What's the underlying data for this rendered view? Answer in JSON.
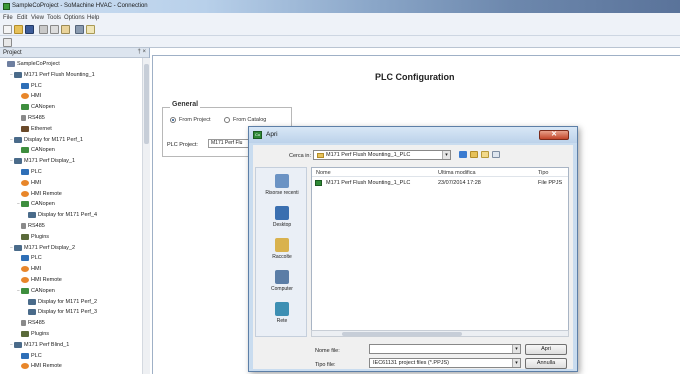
{
  "window": {
    "title": "SampleCoProject - SoMachine HVAC - Connection"
  },
  "menu": [
    "File",
    "Edit",
    "View",
    "Tools",
    "Options",
    "Help"
  ],
  "project_panel": {
    "header": "Project",
    "header_controls": "† ×",
    "tree": [
      {
        "label": "SampleCoProject",
        "icon": "project-icon",
        "level": 0,
        "expander": ""
      },
      {
        "label": "M171 Perf Flush Mounting_1",
        "icon": "device-icon",
        "level": 1,
        "expander": "−"
      },
      {
        "label": "PLC",
        "icon": "plc-icon",
        "level": 2,
        "expander": ""
      },
      {
        "label": "HMI",
        "icon": "hmi-icon",
        "level": 2,
        "expander": ""
      },
      {
        "label": "CANopen",
        "icon": "canopen-icon",
        "level": 2,
        "expander": ""
      },
      {
        "label": "RS485",
        "icon": "rs485-icon",
        "level": 2,
        "expander": ""
      },
      {
        "label": "Ethernet",
        "icon": "ethernet-icon",
        "level": 2,
        "expander": ""
      },
      {
        "label": "Display for M171 Perf_1",
        "icon": "device-icon",
        "level": 1,
        "expander": "−"
      },
      {
        "label": "CANopen",
        "icon": "canopen-icon",
        "level": 2,
        "expander": ""
      },
      {
        "label": "M171 Perf Display_1",
        "icon": "device-icon",
        "level": 1,
        "expander": "−"
      },
      {
        "label": "PLC",
        "icon": "plc-icon",
        "level": 2,
        "expander": ""
      },
      {
        "label": "HMI",
        "icon": "hmi-icon",
        "level": 2,
        "expander": ""
      },
      {
        "label": "HMI Remote",
        "icon": "hmi-icon",
        "level": 2,
        "expander": ""
      },
      {
        "label": "CANopen",
        "icon": "canopen-icon",
        "level": 2,
        "expander": "−"
      },
      {
        "label": "Display for M171 Perf_4",
        "icon": "device-icon",
        "level": 3,
        "expander": ""
      },
      {
        "label": "RS485",
        "icon": "rs485-icon",
        "level": 2,
        "expander": ""
      },
      {
        "label": "Plugins",
        "icon": "plugin-icon",
        "level": 2,
        "expander": ""
      },
      {
        "label": "M171 Perf Display_2",
        "icon": "device-icon",
        "level": 1,
        "expander": "−"
      },
      {
        "label": "PLC",
        "icon": "plc-icon",
        "level": 2,
        "expander": ""
      },
      {
        "label": "HMI",
        "icon": "hmi-icon",
        "level": 2,
        "expander": ""
      },
      {
        "label": "HMI Remote",
        "icon": "hmi-icon",
        "level": 2,
        "expander": ""
      },
      {
        "label": "CANopen",
        "icon": "canopen-icon",
        "level": 2,
        "expander": "−"
      },
      {
        "label": "Display for M171 Perf_2",
        "icon": "device-icon",
        "level": 3,
        "expander": ""
      },
      {
        "label": "Display for M171 Perf_3",
        "icon": "device-icon",
        "level": 3,
        "expander": ""
      },
      {
        "label": "RS485",
        "icon": "rs485-icon",
        "level": 2,
        "expander": ""
      },
      {
        "label": "Plugins",
        "icon": "plugin-icon",
        "level": 2,
        "expander": ""
      },
      {
        "label": "M171 Perf Blind_1",
        "icon": "device-icon",
        "level": 1,
        "expander": "−"
      },
      {
        "label": "PLC",
        "icon": "plc-icon",
        "level": 2,
        "expander": ""
      },
      {
        "label": "HMI Remote",
        "icon": "hmi-icon",
        "level": 2,
        "expander": ""
      }
    ]
  },
  "plc_config": {
    "title": "PLC Configuration",
    "general_label": "General",
    "from_project": "From Project",
    "from_catalog": "From Catalog",
    "plc_project_label": "PLC Project:",
    "plc_project_value": "M171 Perf Flu"
  },
  "open_dialog": {
    "title": "Apri",
    "close_symbol": "✕",
    "cerca_label": "Cerca in:",
    "cerca_value": "M171 Perf Flush Mounting_1_PLC",
    "combo_arrow": "▾",
    "places": [
      "Risorse recenti",
      "Desktop",
      "Raccolte",
      "Computer",
      "Rete"
    ],
    "columns": [
      "Nome",
      "Ultima modifica",
      "Tipo"
    ],
    "files": [
      {
        "name": "M171 Perf Flush Mounting_1_PLC",
        "modified": "23/07/2014 17:28",
        "type": "File PPJS"
      }
    ],
    "filename_label": "Nome file:",
    "filename_value": "",
    "filetype_label": "Tipo file:",
    "filetype_value": "IEC61131 project files (*.PPJS)",
    "open_button": "Apri",
    "cancel_button": "Annulla"
  }
}
